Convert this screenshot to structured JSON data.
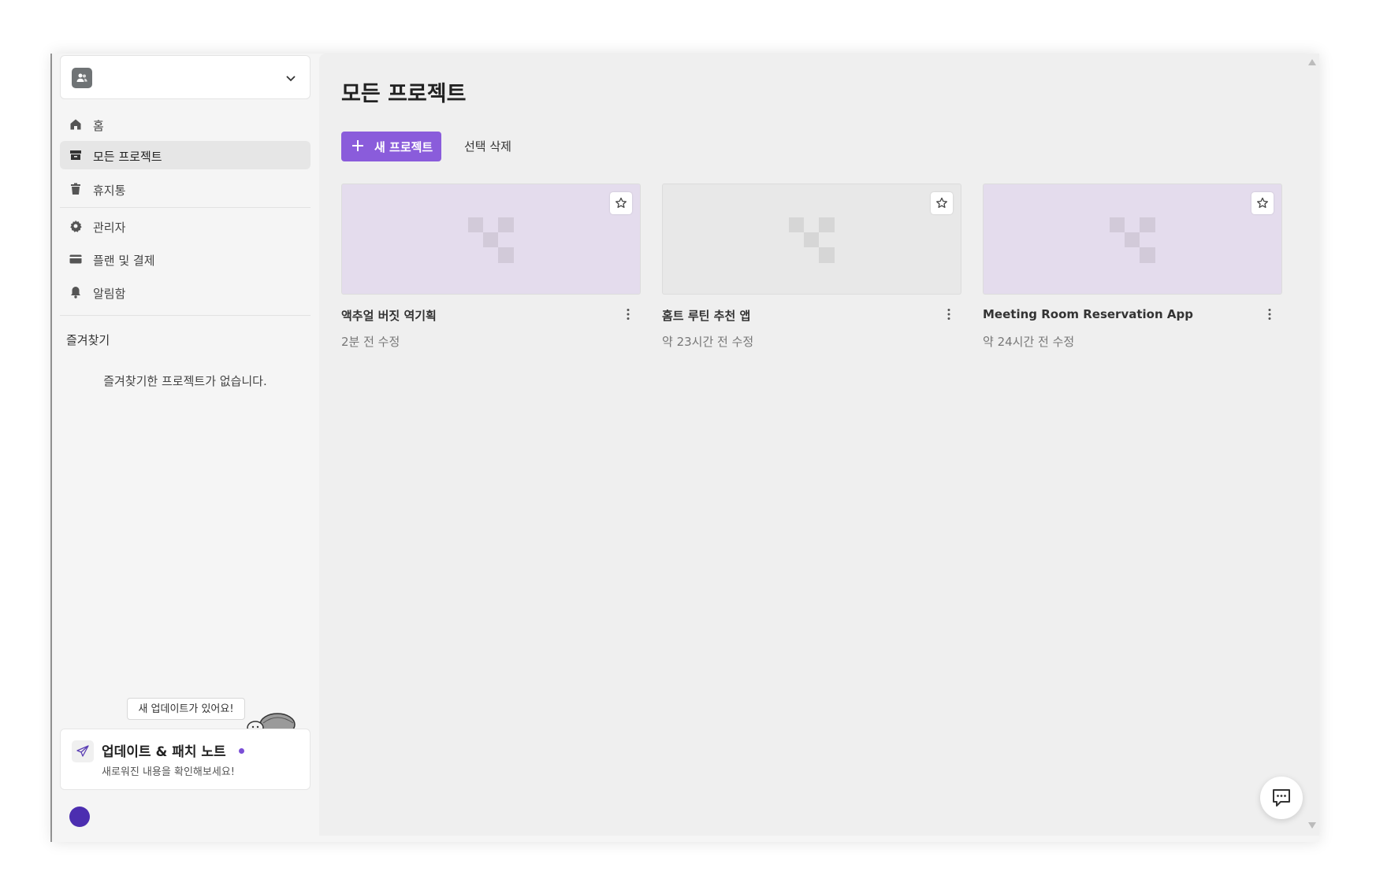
{
  "workspace": {
    "name": ""
  },
  "nav": {
    "home": "홈",
    "all_projects": "모든 프로젝트",
    "trash": "휴지통",
    "admin": "관리자",
    "plans_billing": "플랜 및 결제",
    "notifications": "알림함"
  },
  "favorites": {
    "title": "즐겨찾기",
    "empty": "즐겨찾기한 프로젝트가 없습니다."
  },
  "update": {
    "tooltip": "새 업데이트가 있어요!",
    "title": "업데이트 & 패치 노트",
    "subtitle": "새로워진 내용을 확인해보세요!"
  },
  "main": {
    "title": "모든 프로젝트",
    "new_project": "새 프로젝트",
    "delete_selected": "선택 삭제"
  },
  "projects": [
    {
      "title": "액추얼 버짓 역기획",
      "modified": "2분 전 수정",
      "thumb": "purple"
    },
    {
      "title": "홈트 루틴 추천 앱",
      "modified": "약 23시간 전 수정",
      "thumb": "gray"
    },
    {
      "title": "Meeting Room Reservation App",
      "modified": "약 24시간 전 수정",
      "thumb": "purple"
    }
  ],
  "colors": {
    "accent": "#8a5cdb",
    "avatar": "#4c2eb0"
  }
}
